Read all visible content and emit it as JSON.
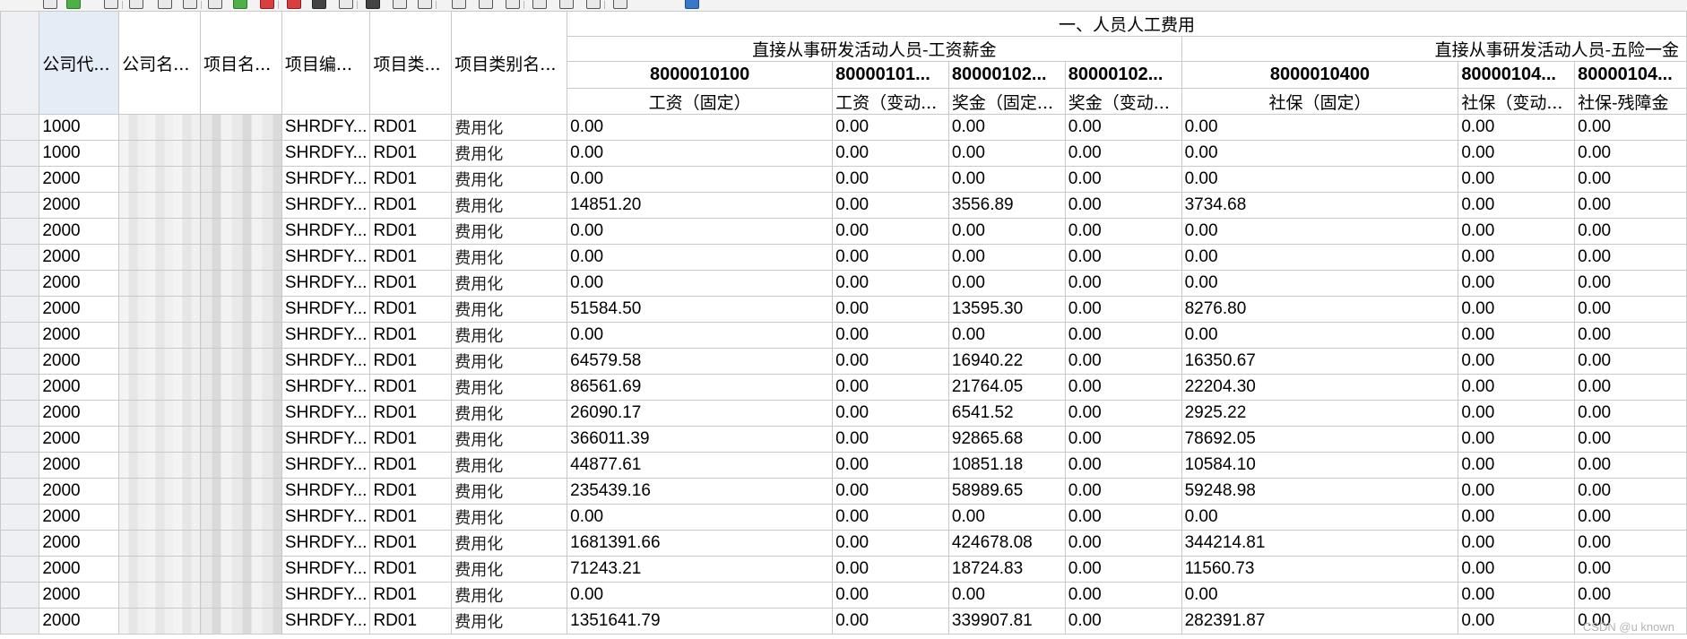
{
  "toolbar": {
    "buttons": [
      {
        "name": "select-all-icon",
        "variant": ""
      },
      {
        "name": "details-icon",
        "variant": "green"
      },
      {
        "name": "sort-icon",
        "variant": ""
      },
      {
        "name": "cut-icon",
        "variant": ""
      },
      {
        "name": "copy-icon",
        "variant": ""
      },
      {
        "name": "paste-icon",
        "variant": ""
      },
      {
        "name": "insert-row-icon",
        "variant": ""
      },
      {
        "name": "append-row-icon",
        "variant": "green"
      },
      {
        "name": "delete-row-icon",
        "variant": "red"
      },
      {
        "name": "delete-column-icon",
        "variant": "red"
      },
      {
        "name": "print-icon",
        "variant": "dark"
      },
      {
        "name": "minus-icon",
        "variant": ""
      },
      {
        "name": "dark-block-icon",
        "variant": "dark"
      },
      {
        "name": "add-column-icon",
        "variant": ""
      },
      {
        "name": "sort-ascending-icon",
        "variant": ""
      },
      {
        "name": "sort-descending-icon",
        "variant": ""
      },
      {
        "name": "sum-icon",
        "variant": ""
      },
      {
        "name": "subtotal-icon",
        "variant": ""
      },
      {
        "name": "clipboard-icon",
        "variant": ""
      },
      {
        "name": "view-icon",
        "variant": ""
      },
      {
        "name": "export-icon",
        "variant": ""
      },
      {
        "name": "layout-icon",
        "variant": ""
      },
      {
        "name": "info-icon",
        "variant": "blue"
      }
    ]
  },
  "header": {
    "group_title": "一、人员人工费用",
    "subgroup_wages": "直接从事研发活动人员-工资薪金",
    "subgroup_insurance": "直接从事研发活动人员-五险一金",
    "left_columns": [
      "公司代...",
      "公司名...",
      "项目名...",
      "项目编...",
      "项目类...",
      "项目类别名..."
    ],
    "codes": [
      "8000010100",
      "80000101...",
      "80000102...",
      "80000102...",
      "8000010400",
      "80000104...",
      "80000104..."
    ],
    "names": [
      "工资（固定）",
      "工资（变动...",
      "奖金（固定...",
      "奖金（变动...",
      "社保（固定）",
      "社保（变动...",
      "社保-残障金"
    ]
  },
  "rows": [
    {
      "company_code": "1000",
      "project_code": "SHRDFY...",
      "category": "RD01",
      "category_name": "费用化",
      "values": [
        "0.00",
        "0.00",
        "0.00",
        "0.00",
        "0.00",
        "0.00",
        "0.00"
      ]
    },
    {
      "company_code": "1000",
      "project_code": "SHRDFY...",
      "category": "RD01",
      "category_name": "费用化",
      "values": [
        "0.00",
        "0.00",
        "0.00",
        "0.00",
        "0.00",
        "0.00",
        "0.00"
      ]
    },
    {
      "company_code": "2000",
      "project_code": "SHRDFY...",
      "category": "RD01",
      "category_name": "费用化",
      "values": [
        "0.00",
        "0.00",
        "0.00",
        "0.00",
        "0.00",
        "0.00",
        "0.00"
      ]
    },
    {
      "company_code": "2000",
      "project_code": "SHRDFY...",
      "category": "RD01",
      "category_name": "费用化",
      "values": [
        "14851.20",
        "0.00",
        "3556.89",
        "0.00",
        "3734.68",
        "0.00",
        "0.00"
      ]
    },
    {
      "company_code": "2000",
      "project_code": "SHRDFY...",
      "category": "RD01",
      "category_name": "费用化",
      "values": [
        "0.00",
        "0.00",
        "0.00",
        "0.00",
        "0.00",
        "0.00",
        "0.00"
      ]
    },
    {
      "company_code": "2000",
      "project_code": "SHRDFY...",
      "category": "RD01",
      "category_name": "费用化",
      "values": [
        "0.00",
        "0.00",
        "0.00",
        "0.00",
        "0.00",
        "0.00",
        "0.00"
      ]
    },
    {
      "company_code": "2000",
      "project_code": "SHRDFY...",
      "category": "RD01",
      "category_name": "费用化",
      "values": [
        "0.00",
        "0.00",
        "0.00",
        "0.00",
        "0.00",
        "0.00",
        "0.00"
      ]
    },
    {
      "company_code": "2000",
      "project_code": "SHRDFY...",
      "category": "RD01",
      "category_name": "费用化",
      "values": [
        "51584.50",
        "0.00",
        "13595.30",
        "0.00",
        "8276.80",
        "0.00",
        "0.00"
      ]
    },
    {
      "company_code": "2000",
      "project_code": "SHRDFY...",
      "category": "RD01",
      "category_name": "费用化",
      "values": [
        "0.00",
        "0.00",
        "0.00",
        "0.00",
        "0.00",
        "0.00",
        "0.00"
      ]
    },
    {
      "company_code": "2000",
      "project_code": "SHRDFY...",
      "category": "RD01",
      "category_name": "费用化",
      "values": [
        "64579.58",
        "0.00",
        "16940.22",
        "0.00",
        "16350.67",
        "0.00",
        "0.00"
      ]
    },
    {
      "company_code": "2000",
      "project_code": "SHRDFY...",
      "category": "RD01",
      "category_name": "费用化",
      "values": [
        "86561.69",
        "0.00",
        "21764.05",
        "0.00",
        "22204.30",
        "0.00",
        "0.00"
      ]
    },
    {
      "company_code": "2000",
      "project_code": "SHRDFY...",
      "category": "RD01",
      "category_name": "费用化",
      "values": [
        "26090.17",
        "0.00",
        "6541.52",
        "0.00",
        "2925.22",
        "0.00",
        "0.00"
      ]
    },
    {
      "company_code": "2000",
      "project_code": "SHRDFY...",
      "category": "RD01",
      "category_name": "费用化",
      "values": [
        "366011.39",
        "0.00",
        "92865.68",
        "0.00",
        "78692.05",
        "0.00",
        "0.00"
      ]
    },
    {
      "company_code": "2000",
      "project_code": "SHRDFY...",
      "category": "RD01",
      "category_name": "费用化",
      "values": [
        "44877.61",
        "0.00",
        "10851.18",
        "0.00",
        "10584.10",
        "0.00",
        "0.00"
      ]
    },
    {
      "company_code": "2000",
      "project_code": "SHRDFY...",
      "category": "RD01",
      "category_name": "费用化",
      "values": [
        "235439.16",
        "0.00",
        "58989.65",
        "0.00",
        "59248.98",
        "0.00",
        "0.00"
      ]
    },
    {
      "company_code": "2000",
      "project_code": "SHRDFY...",
      "category": "RD01",
      "category_name": "费用化",
      "values": [
        "0.00",
        "0.00",
        "0.00",
        "0.00",
        "0.00",
        "0.00",
        "0.00"
      ]
    },
    {
      "company_code": "2000",
      "project_code": "SHRDFY...",
      "category": "RD01",
      "category_name": "费用化",
      "values": [
        "1681391.66",
        "0.00",
        "424678.08",
        "0.00",
        "344214.81",
        "0.00",
        "0.00"
      ]
    },
    {
      "company_code": "2000",
      "project_code": "SHRDFY...",
      "category": "RD01",
      "category_name": "费用化",
      "values": [
        "71243.21",
        "0.00",
        "18724.83",
        "0.00",
        "11560.73",
        "0.00",
        "0.00"
      ]
    },
    {
      "company_code": "2000",
      "project_code": "SHRDFY...",
      "category": "RD01",
      "category_name": "费用化",
      "values": [
        "0.00",
        "0.00",
        "0.00",
        "0.00",
        "0.00",
        "0.00",
        "0.00"
      ]
    },
    {
      "company_code": "2000",
      "project_code": "SHRDFY...",
      "category": "RD01",
      "category_name": "费用化",
      "values": [
        "1351641.79",
        "0.00",
        "339907.81",
        "0.00",
        "282391.87",
        "0.00",
        "0.00"
      ]
    }
  ],
  "watermark": "CSDN @u known"
}
